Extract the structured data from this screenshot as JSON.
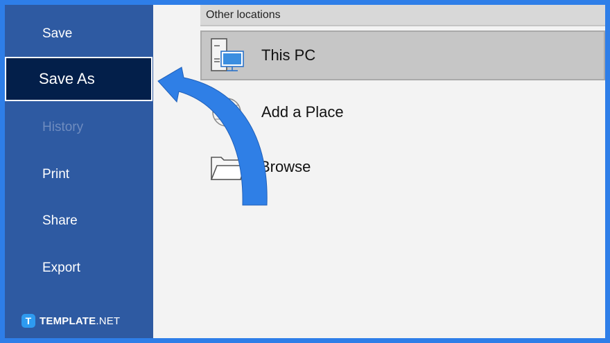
{
  "sidebar": {
    "items": [
      {
        "label": "Save",
        "state": "normal"
      },
      {
        "label": "Save As",
        "state": "active"
      },
      {
        "label": "History",
        "state": "disabled"
      },
      {
        "label": "Print",
        "state": "normal"
      },
      {
        "label": "Share",
        "state": "normal"
      },
      {
        "label": "Export",
        "state": "normal"
      }
    ]
  },
  "main": {
    "section_title": "Other locations",
    "locations": [
      {
        "label": "This PC",
        "icon": "computer-icon",
        "selected": true
      },
      {
        "label": "Add a Place",
        "icon": "globe-icon",
        "selected": false
      },
      {
        "label": "Browse",
        "icon": "folder-icon",
        "selected": false
      }
    ]
  },
  "brand": {
    "logo_letter": "T",
    "name": "TEMPLATE",
    "suffix": ".NET"
  },
  "colors": {
    "frame": "#2e7ee8",
    "sidebar": "#2e5aa2",
    "active_item": "#031f4a",
    "arrow": "#2f7fe6"
  }
}
